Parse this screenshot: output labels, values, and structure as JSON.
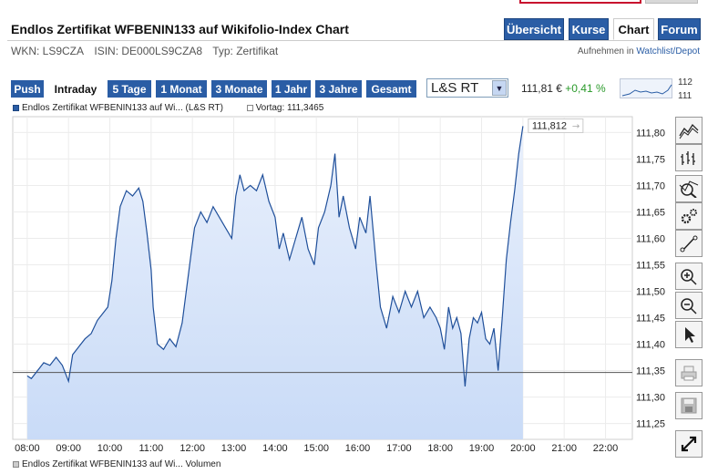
{
  "header": {
    "title": "Endlos Zertifikat WFBENIN133 auf Wikifolio-Index Chart",
    "wkn": "WKN: LS9CZA",
    "isin": "ISIN: DE000LS9CZA8",
    "typ": "Typ: Zertifikat"
  },
  "nav": {
    "tabs": [
      {
        "label": "Übersicht",
        "active": false
      },
      {
        "label": "Kurse",
        "active": false
      },
      {
        "label": "Chart",
        "active": true
      },
      {
        "label": "Forum",
        "active": false
      }
    ],
    "watchlist_prefix": "Aufnehmen in",
    "watchlist_link": "Watchlist/Depot"
  },
  "ranges": [
    {
      "label": "Push",
      "active": false
    },
    {
      "label": "Intraday",
      "active": true
    },
    {
      "label": "5 Tage",
      "active": false
    },
    {
      "label": "1 Monat",
      "active": false
    },
    {
      "label": "3 Monate",
      "active": false
    },
    {
      "label": "1 Jahr",
      "active": false
    },
    {
      "label": "3 Jahre",
      "active": false
    },
    {
      "label": "Gesamt",
      "active": false
    }
  ],
  "exchange_select": {
    "value": "L&S RT"
  },
  "quote": {
    "price": "111,81 €",
    "change": "+0,41 %"
  },
  "thumbnail": {
    "top_label": "112",
    "bottom_label": "111"
  },
  "legend": {
    "series_label": "Endlos Zertifikat WFBENIN133 auf Wi... (L&S RT)",
    "prev_label": "Vortag: 111,3465"
  },
  "bottom_legend": {
    "label": "Endlos Zertifikat WFBENIN133 auf Wi... Volumen"
  },
  "tools": [
    "line-chart-icon",
    "ohlc-chart-icon",
    "indicator-icon",
    "settings-icon",
    "draw-line-icon",
    "zoom-in-icon",
    "zoom-out-icon",
    "pointer-icon",
    "print-icon",
    "save-icon",
    "fullscreen-icon"
  ],
  "colors": {
    "accent": "#2a5da5",
    "line": "#1f4f9a",
    "fill": "#c9dbf7",
    "positive": "#2a9a2a"
  },
  "chart_data": {
    "type": "area",
    "x_ticks": [
      "08:00",
      "09:00",
      "10:00",
      "11:00",
      "12:00",
      "13:00",
      "14:00",
      "15:00",
      "16:00",
      "17:00",
      "18:00",
      "19:00",
      "20:00",
      "21:00",
      "22:00"
    ],
    "y_ticks": [
      "111,80",
      "111,75",
      "111,70",
      "111,65",
      "111,60",
      "111,55",
      "111,50",
      "111,45",
      "111,40",
      "111,35",
      "111,30",
      "111,25"
    ],
    "ylim": [
      111.22,
      111.83
    ],
    "xlim": [
      7.65,
      22.65
    ],
    "previous_close": 111.3465,
    "last_label": "111,812",
    "series": [
      {
        "points": [
          [
            8.0,
            111.34
          ],
          [
            8.1,
            111.335
          ],
          [
            8.25,
            111.35
          ],
          [
            8.4,
            111.365
          ],
          [
            8.55,
            111.36
          ],
          [
            8.7,
            111.375
          ],
          [
            8.85,
            111.36
          ],
          [
            9.0,
            111.33
          ],
          [
            9.1,
            111.38
          ],
          [
            9.25,
            111.395
          ],
          [
            9.4,
            111.41
          ],
          [
            9.55,
            111.42
          ],
          [
            9.7,
            111.445
          ],
          [
            9.85,
            111.46
          ],
          [
            9.95,
            111.47
          ],
          [
            10.05,
            111.52
          ],
          [
            10.15,
            111.6
          ],
          [
            10.25,
            111.66
          ],
          [
            10.4,
            111.69
          ],
          [
            10.55,
            111.68
          ],
          [
            10.7,
            111.695
          ],
          [
            10.8,
            111.67
          ],
          [
            10.9,
            111.61
          ],
          [
            11.0,
            111.54
          ],
          [
            11.05,
            111.47
          ],
          [
            11.15,
            111.4
          ],
          [
            11.3,
            111.39
          ],
          [
            11.45,
            111.41
          ],
          [
            11.6,
            111.395
          ],
          [
            11.75,
            111.44
          ],
          [
            11.85,
            111.5
          ],
          [
            11.95,
            111.56
          ],
          [
            12.05,
            111.62
          ],
          [
            12.2,
            111.65
          ],
          [
            12.35,
            111.63
          ],
          [
            12.5,
            111.66
          ],
          [
            12.65,
            111.64
          ],
          [
            12.8,
            111.62
          ],
          [
            12.95,
            111.6
          ],
          [
            13.05,
            111.68
          ],
          [
            13.15,
            111.72
          ],
          [
            13.25,
            111.69
          ],
          [
            13.4,
            111.7
          ],
          [
            13.55,
            111.69
          ],
          [
            13.7,
            111.72
          ],
          [
            13.85,
            111.67
          ],
          [
            14.0,
            111.64
          ],
          [
            14.1,
            111.58
          ],
          [
            14.2,
            111.61
          ],
          [
            14.35,
            111.56
          ],
          [
            14.5,
            111.6
          ],
          [
            14.65,
            111.64
          ],
          [
            14.8,
            111.58
          ],
          [
            14.95,
            111.55
          ],
          [
            15.05,
            111.62
          ],
          [
            15.2,
            111.65
          ],
          [
            15.35,
            111.7
          ],
          [
            15.45,
            111.76
          ],
          [
            15.55,
            111.64
          ],
          [
            15.65,
            111.68
          ],
          [
            15.8,
            111.62
          ],
          [
            15.95,
            111.58
          ],
          [
            16.05,
            111.64
          ],
          [
            16.2,
            111.61
          ],
          [
            16.3,
            111.68
          ],
          [
            16.45,
            111.55
          ],
          [
            16.55,
            111.47
          ],
          [
            16.7,
            111.43
          ],
          [
            16.85,
            111.49
          ],
          [
            17.0,
            111.46
          ],
          [
            17.15,
            111.5
          ],
          [
            17.3,
            111.47
          ],
          [
            17.45,
            111.5
          ],
          [
            17.6,
            111.45
          ],
          [
            17.75,
            111.47
          ],
          [
            17.9,
            111.45
          ],
          [
            18.0,
            111.43
          ],
          [
            18.1,
            111.39
          ],
          [
            18.2,
            111.47
          ],
          [
            18.3,
            111.43
          ],
          [
            18.4,
            111.45
          ],
          [
            18.5,
            111.42
          ],
          [
            18.6,
            111.32
          ],
          [
            18.7,
            111.41
          ],
          [
            18.8,
            111.45
          ],
          [
            18.9,
            111.44
          ],
          [
            19.0,
            111.46
          ],
          [
            19.1,
            111.41
          ],
          [
            19.2,
            111.4
          ],
          [
            19.3,
            111.43
          ],
          [
            19.4,
            111.35
          ],
          [
            19.5,
            111.45
          ],
          [
            19.6,
            111.56
          ],
          [
            19.7,
            111.63
          ],
          [
            19.8,
            111.69
          ],
          [
            19.9,
            111.76
          ],
          [
            20.0,
            111.812
          ]
        ]
      }
    ]
  }
}
